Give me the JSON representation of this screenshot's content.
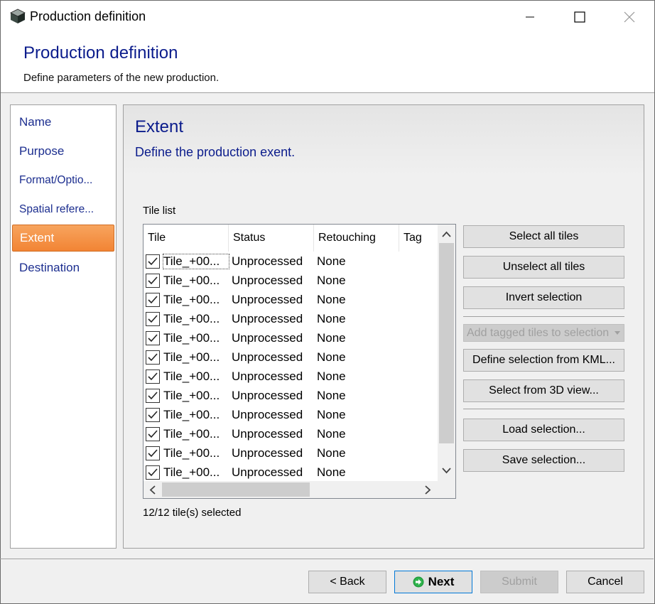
{
  "window": {
    "title": "Production definition"
  },
  "header": {
    "title": "Production definition",
    "subtitle": "Define parameters of the new production."
  },
  "nav": {
    "items": [
      {
        "label": "Name"
      },
      {
        "label": "Purpose"
      },
      {
        "label": "Format/Optio..."
      },
      {
        "label": "Spatial refere..."
      },
      {
        "label": "Extent",
        "active": true
      },
      {
        "label": "Destination"
      }
    ]
  },
  "content": {
    "title": "Extent",
    "subtitle": "Define the production exent.",
    "tile_list_label": "Tile list",
    "selection_count": "12/12 tile(s) selected"
  },
  "table": {
    "columns": [
      "Tile",
      "Status",
      "Retouching",
      "Tag"
    ],
    "rows": [
      {
        "checked": true,
        "tile": "Tile_+00...",
        "status": "Unprocessed",
        "retouching": "None"
      },
      {
        "checked": true,
        "tile": "Tile_+00...",
        "status": "Unprocessed",
        "retouching": "None"
      },
      {
        "checked": true,
        "tile": "Tile_+00...",
        "status": "Unprocessed",
        "retouching": "None"
      },
      {
        "checked": true,
        "tile": "Tile_+00...",
        "status": "Unprocessed",
        "retouching": "None"
      },
      {
        "checked": true,
        "tile": "Tile_+00...",
        "status": "Unprocessed",
        "retouching": "None"
      },
      {
        "checked": true,
        "tile": "Tile_+00...",
        "status": "Unprocessed",
        "retouching": "None"
      },
      {
        "checked": true,
        "tile": "Tile_+00...",
        "status": "Unprocessed",
        "retouching": "None"
      },
      {
        "checked": true,
        "tile": "Tile_+00...",
        "status": "Unprocessed",
        "retouching": "None"
      },
      {
        "checked": true,
        "tile": "Tile_+00...",
        "status": "Unprocessed",
        "retouching": "None"
      },
      {
        "checked": true,
        "tile": "Tile_+00...",
        "status": "Unprocessed",
        "retouching": "None"
      },
      {
        "checked": true,
        "tile": "Tile_+00...",
        "status": "Unprocessed",
        "retouching": "None"
      },
      {
        "checked": true,
        "tile": "Tile_+00...",
        "status": "Unprocessed",
        "retouching": "None"
      }
    ]
  },
  "actions": {
    "select_all": "Select all tiles",
    "unselect_all": "Unselect all tiles",
    "invert": "Invert selection",
    "add_tagged": "Add tagged tiles to selection",
    "define_kml": "Define selection from KML...",
    "select_3d": "Select from 3D view...",
    "load": "Load selection...",
    "save": "Save selection..."
  },
  "footer": {
    "back": "< Back",
    "next": "Next",
    "submit": "Submit",
    "cancel": "Cancel"
  },
  "colors": {
    "accent_orange": "#f28434",
    "title_blue": "#0b1c8c",
    "nav_blue": "#1c2e8f",
    "next_icon_green": "#1e9a3a"
  }
}
